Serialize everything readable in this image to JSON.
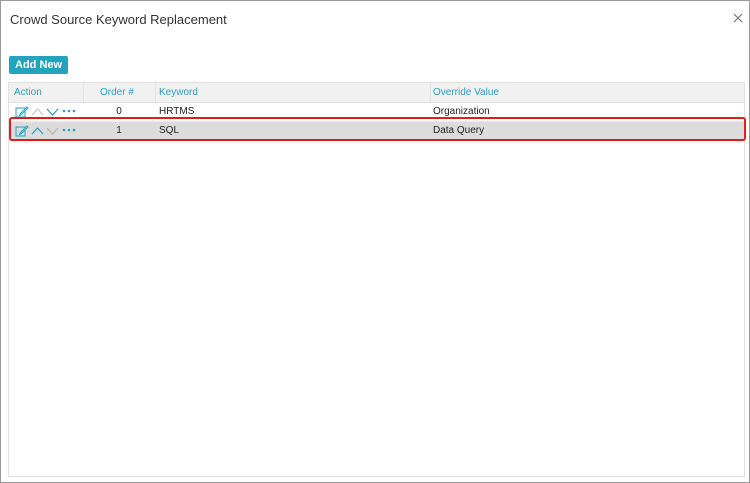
{
  "dialog": {
    "title": "Crowd Source Keyword Replacement",
    "close_icon": "close-icon"
  },
  "toolbar": {
    "add_new_label": "Add New"
  },
  "table": {
    "columns": [
      "Action",
      "Order #",
      "Keyword",
      "Override Value"
    ],
    "rows": [
      {
        "order": "0",
        "keyword": "HRTMS",
        "override": "Organization",
        "selected": false
      },
      {
        "order": "1",
        "keyword": "SQL",
        "override": "Data Query",
        "selected": true
      }
    ],
    "row_action_icons": [
      "edit-icon",
      "move-up-icon",
      "move-down-icon",
      "more-options-icon"
    ]
  },
  "colors": {
    "accent": "#23a3bd",
    "header_text": "#2a9fc1",
    "selected_row": "#dcdcdc",
    "highlight_border": "#e21b1b"
  }
}
